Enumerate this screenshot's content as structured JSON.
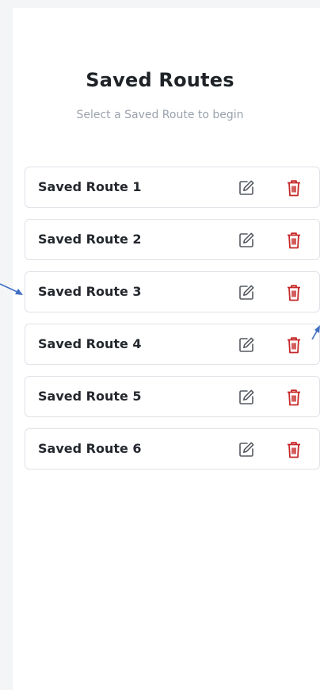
{
  "page": {
    "title": "Saved Routes",
    "subtitle": "Select a Saved Route to begin"
  },
  "routes": [
    {
      "label": "Saved Route 1",
      "edit_icon": "edit-icon",
      "delete_icon": "trash-icon"
    },
    {
      "label": "Saved Route 2",
      "edit_icon": "edit-icon",
      "delete_icon": "trash-icon"
    },
    {
      "label": "Saved Route 3",
      "edit_icon": "edit-icon",
      "delete_icon": "trash-icon"
    },
    {
      "label": "Saved Route 4",
      "edit_icon": "edit-icon",
      "delete_icon": "trash-icon"
    },
    {
      "label": "Saved Route 5",
      "edit_icon": "edit-icon",
      "delete_icon": "trash-icon"
    },
    {
      "label": "Saved Route 6",
      "edit_icon": "edit-icon",
      "delete_icon": "trash-icon"
    }
  ],
  "colors": {
    "delete_icon": "#c62828",
    "edit_icon": "#555a62",
    "annotation_arrow": "#3f6fc4"
  }
}
